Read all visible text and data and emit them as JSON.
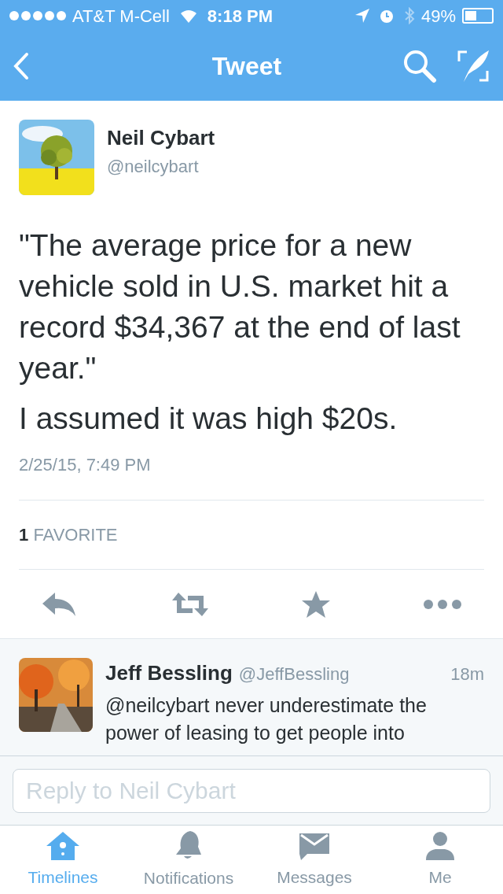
{
  "status_bar": {
    "carrier": "AT&T M-Cell",
    "time": "8:18 PM",
    "battery": "49%"
  },
  "nav": {
    "title": "Tweet"
  },
  "tweet": {
    "name": "Neil Cybart",
    "handle": "@neilcybart",
    "paragraphs": [
      "\"The average price for a new vehicle sold in U.S. market hit a record $34,367 at the end of last year.\"",
      "I assumed it was high $20s."
    ],
    "timestamp": "2/25/15, 7:49 PM",
    "favorites": {
      "count": "1",
      "label": "FAVORITE"
    }
  },
  "reply": {
    "name": "Jeff Bessling",
    "handle": "@JeffBessling",
    "age": "18m",
    "text": "@neilcybart never underestimate the power of leasing to get people into"
  },
  "reply_field": {
    "placeholder": "Reply to Neil Cybart"
  },
  "tabs": [
    {
      "label": "Timelines",
      "selected": true
    },
    {
      "label": "Notifications",
      "selected": false
    },
    {
      "label": "Messages",
      "selected": false
    },
    {
      "label": "Me",
      "selected": false
    }
  ]
}
